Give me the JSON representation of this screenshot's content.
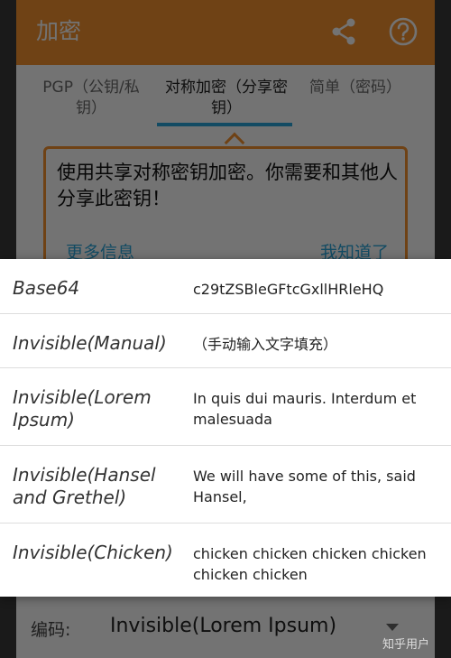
{
  "app_bar": {
    "title": "加密",
    "share_icon": "share-icon",
    "help_icon": "help-icon",
    "accent_color": "#f5922f"
  },
  "tabs": [
    {
      "label": "PGP（公钥/私钥）",
      "selected": false
    },
    {
      "label": "对称加密（分享密钥）",
      "selected": true
    },
    {
      "label": "简单（密码）",
      "selected": false
    }
  ],
  "tip": {
    "text": "使用共享对称密钥加密。你需要和其他人分享此密钥！",
    "more_label": "更多信息",
    "ok_label": "我知道了",
    "link_color": "#2ba6db"
  },
  "encoding": {
    "label": "编码:",
    "value": "Invisible(Lorem Ipsum)"
  },
  "options": [
    {
      "name": "Base64",
      "sample": "c29tZSBleGFtcGxllHRleHQ"
    },
    {
      "name": "Invisible(Manual)",
      "sample": "（手动输入文字填充）"
    },
    {
      "name": "Invisible(Lorem Ipsum)",
      "sample": "In quis dui mauris. Interdum et malesuada"
    },
    {
      "name": "Invisible(Hansel and Grethel)",
      "sample": "We will have some of this, said Hansel,"
    },
    {
      "name": "Invisible(Chicken)",
      "sample": "chicken chicken chicken chicken chicken chicken"
    }
  ],
  "watermark": "知乎用户"
}
